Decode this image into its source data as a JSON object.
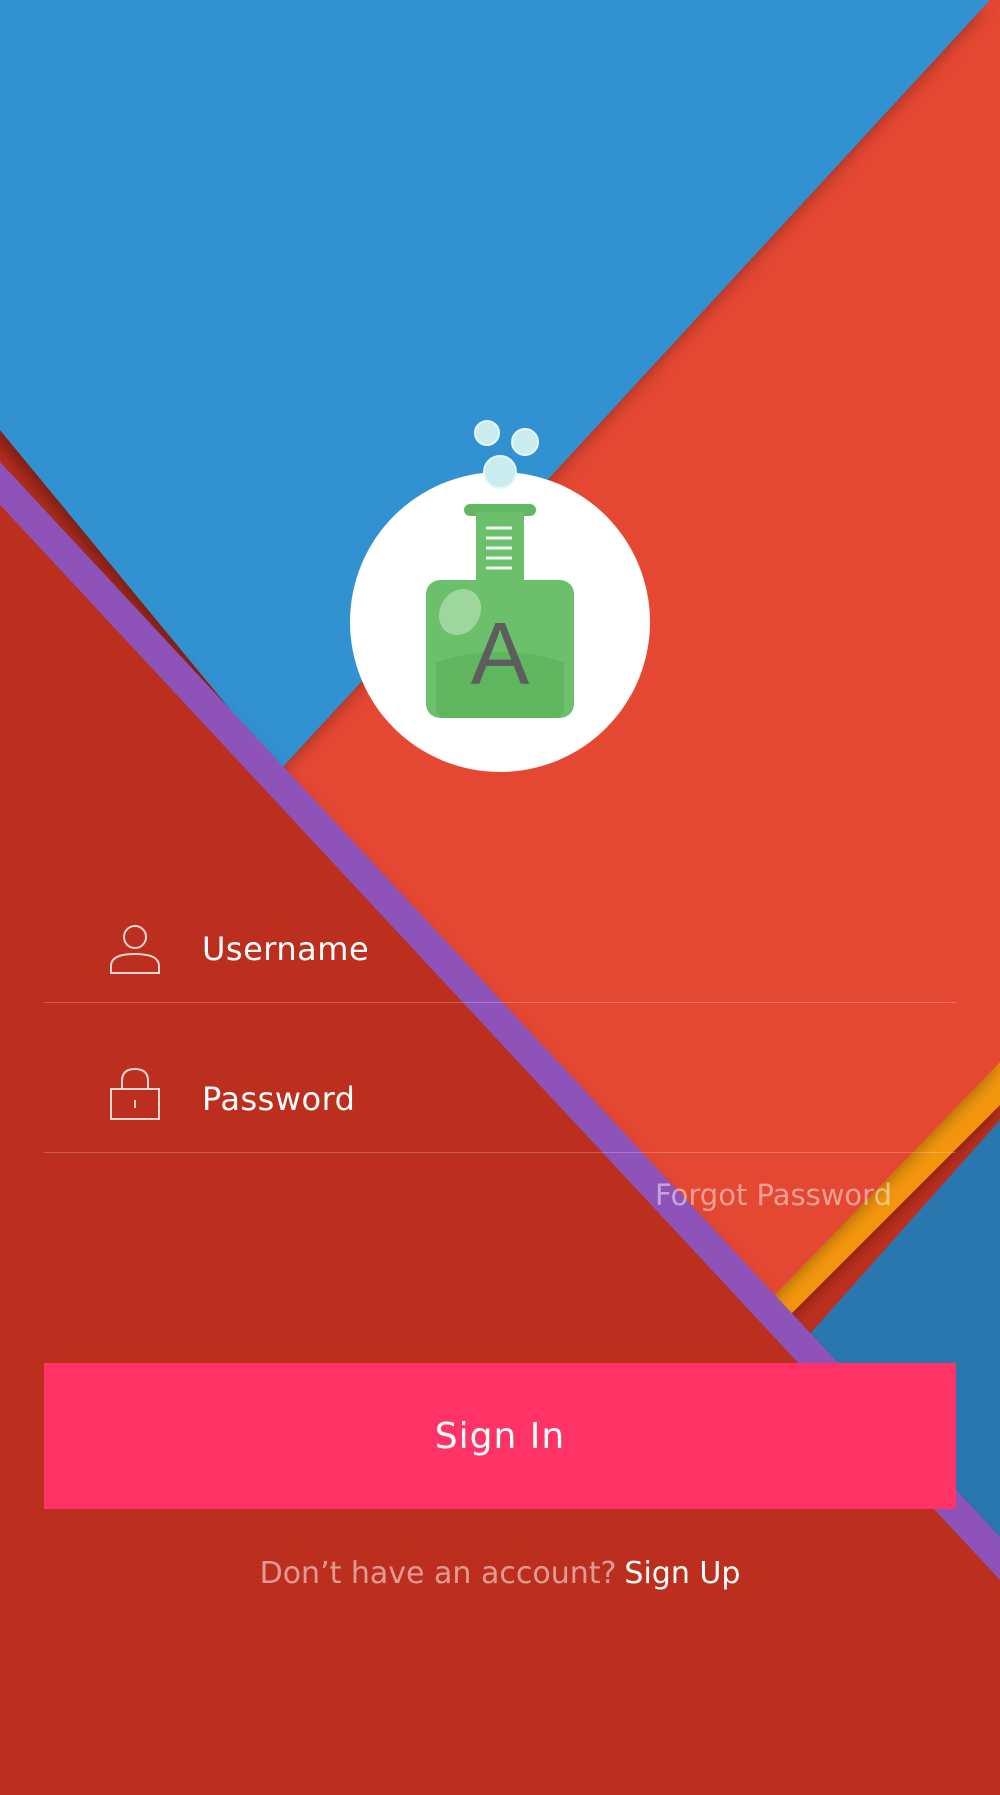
{
  "app": {
    "logo_letter": "A"
  },
  "form": {
    "username": {
      "label": "Username",
      "icon": "user-icon"
    },
    "password": {
      "label": "Password",
      "icon": "lock-icon"
    },
    "forgot_password": "Forgot Password",
    "sign_in": "Sign In",
    "signup_prompt": "Don’t have an account?",
    "signup_link": "Sign Up"
  },
  "colors": {
    "background_red": "#bc2f1f",
    "panel_red": "#e44631",
    "blue": "#3391d1",
    "purple": "#8d52b8",
    "orange": "#f2960d",
    "accent_pink": "#ff3366",
    "flask_green": "#6cc06b"
  }
}
